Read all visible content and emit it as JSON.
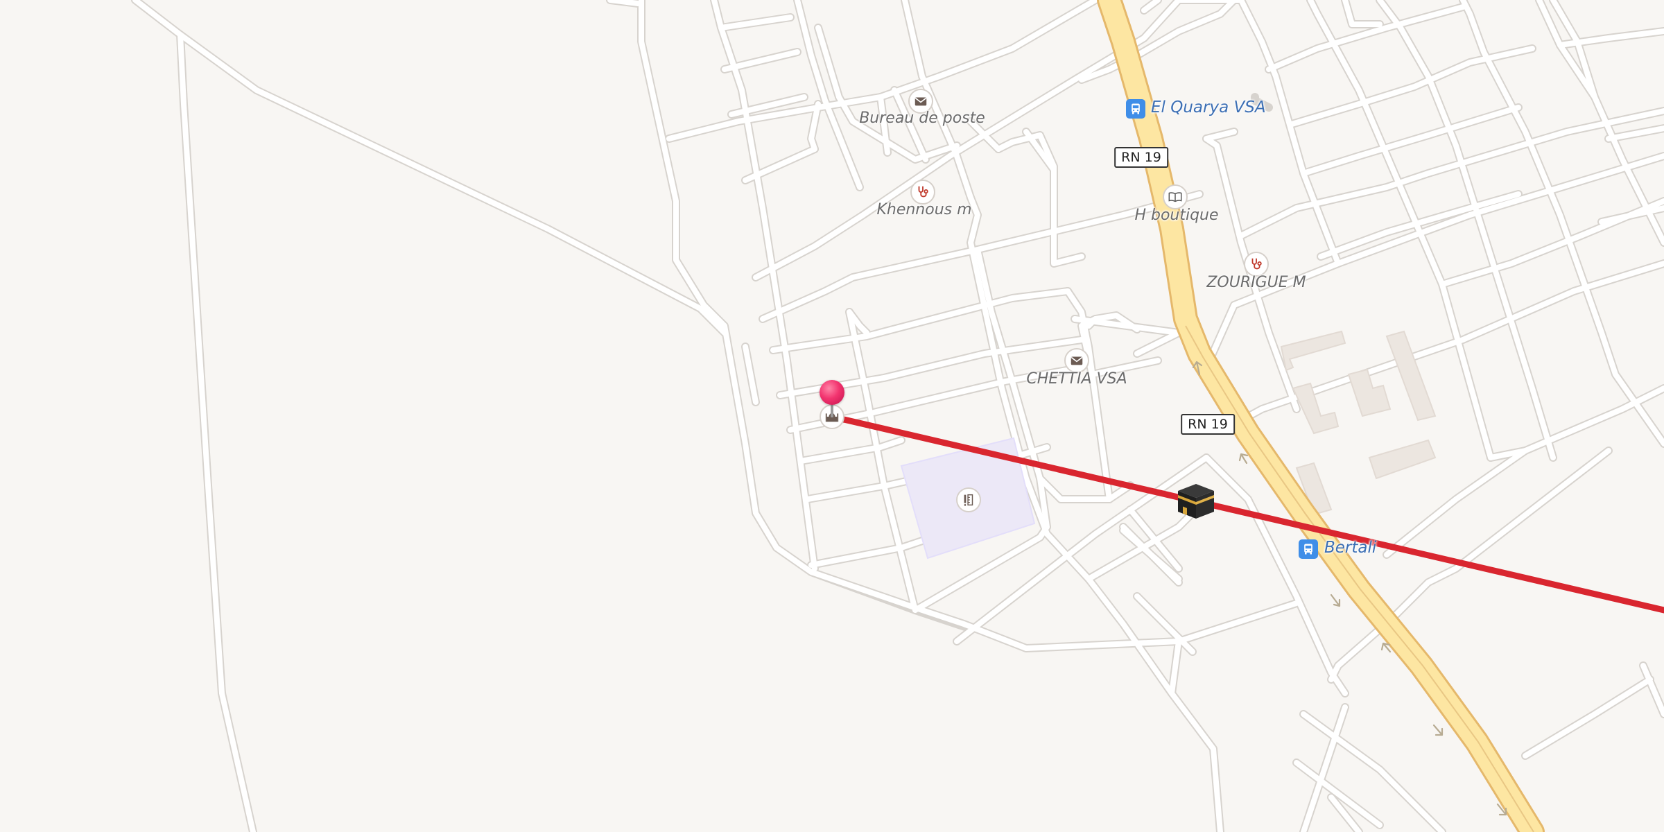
{
  "map": {
    "places": {
      "post_office_1": "Bureau de poste",
      "clinic_1": "Khennous m",
      "shop": "H boutique",
      "clinic_2": "ZOURIGUE M",
      "post_office_2": "CHETTIA VSA"
    },
    "transit_stops": {
      "stop_1": "El Quarya VSA",
      "stop_2": "Bertali"
    },
    "road_shields": {
      "shield_1": "RN 19",
      "shield_2": "RN 19"
    },
    "markers": {
      "location": "location-pin",
      "qibla": "kaaba"
    },
    "colors": {
      "route_line": "#d9262f",
      "pin": "#f2346f",
      "highway": "#fde6a2",
      "transit": "#3f8ee8",
      "background": "#f8f6f3"
    }
  }
}
